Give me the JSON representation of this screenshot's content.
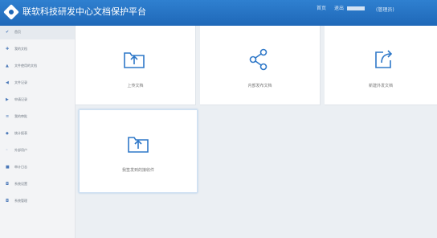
{
  "app": {
    "title": "联软科技研发中心文档保护平台"
  },
  "header": {
    "link1": "首页",
    "link2": "退出",
    "meta": "(管理员)"
  },
  "sidebar": {
    "items": [
      {
        "icon": "✔",
        "label": "首页"
      },
      {
        "icon": "✚",
        "label": "我的文档"
      },
      {
        "icon": "▲",
        "label": "文件使用的文档"
      },
      {
        "icon": "◀",
        "label": "文件记录"
      },
      {
        "icon": "▶",
        "label": "申请记录"
      },
      {
        "icon": "≡",
        "label": "我的审批"
      },
      {
        "icon": "◆",
        "label": "统计报表"
      },
      {
        "icon": "◦",
        "label": "外部用户"
      },
      {
        "icon": "■",
        "label": "审计日志"
      },
      {
        "icon": "◘",
        "label": "系统设置"
      },
      {
        "icon": "◘",
        "label": "系统管理"
      }
    ]
  },
  "cards": [
    {
      "label": "上传文档",
      "icon": "upload-folder-icon"
    },
    {
      "label": "内部发布文档",
      "icon": "share-icon"
    },
    {
      "label": "新建外发文档",
      "icon": "external-share-icon"
    },
    {
      "label": "我签发到的接收件",
      "icon": "folder-upload-icon"
    }
  ]
}
